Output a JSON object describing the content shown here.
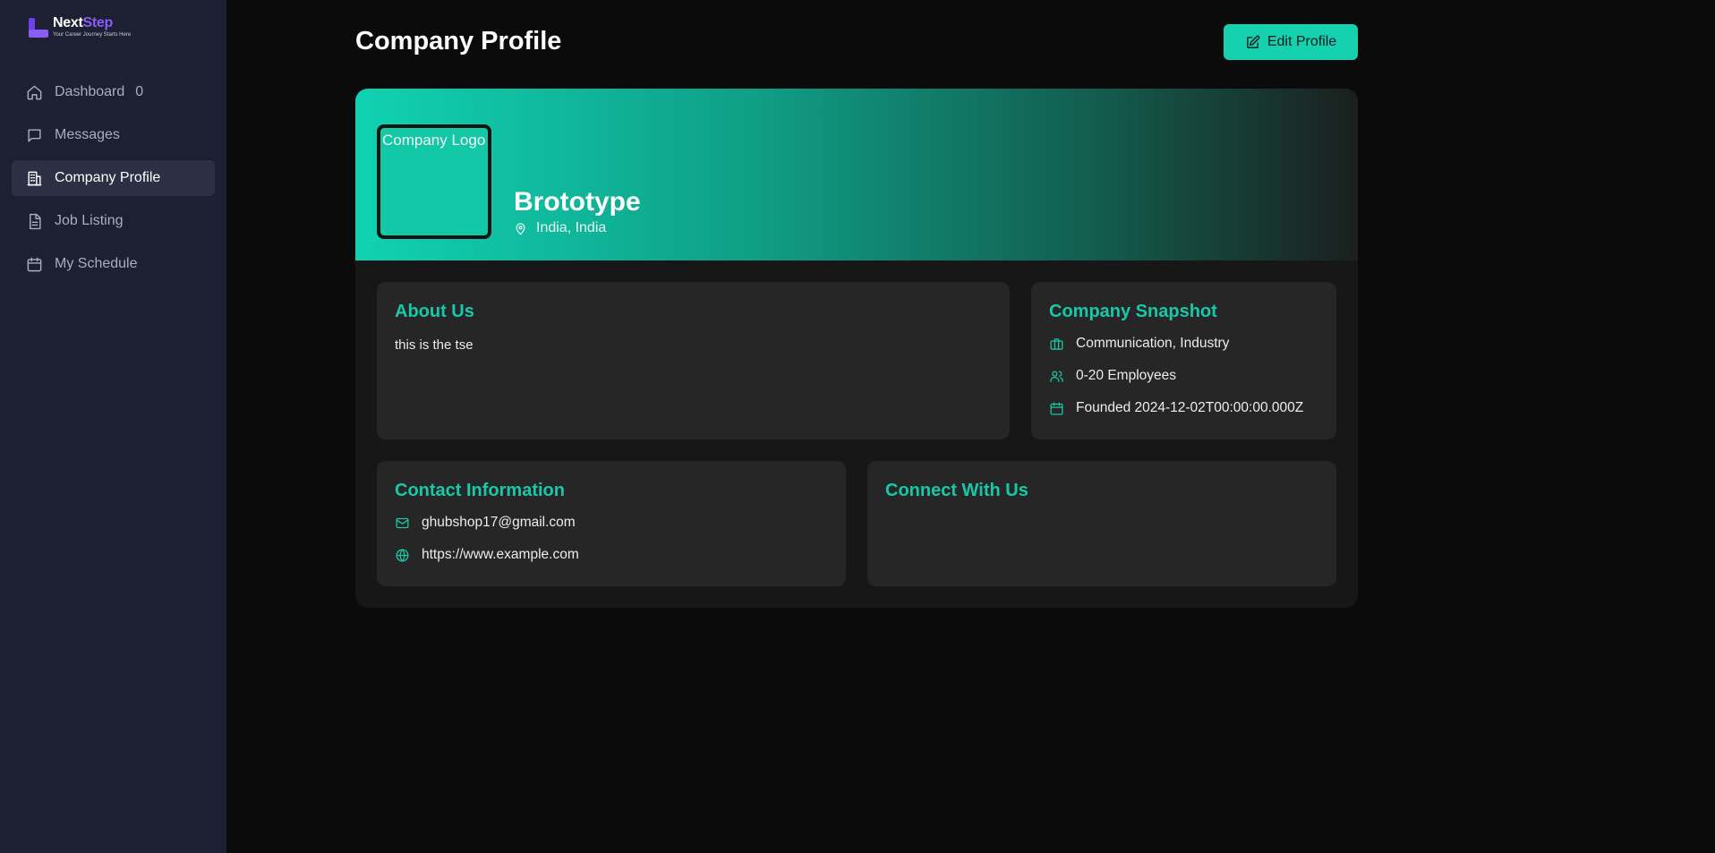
{
  "brand": {
    "name_part1": "Next",
    "name_part2": "Step",
    "tagline": "Your Career Journey Starts Here"
  },
  "sidebar": {
    "items": [
      {
        "label": "Dashboard",
        "badge": "0",
        "icon": "home-icon"
      },
      {
        "label": "Messages",
        "icon": "message-icon"
      },
      {
        "label": "Company Profile",
        "icon": "building-icon",
        "active": true
      },
      {
        "label": "Job Listing",
        "icon": "document-icon"
      },
      {
        "label": "My Schedule",
        "icon": "calendar-icon"
      }
    ]
  },
  "header": {
    "title": "Company Profile",
    "edit_label": "Edit Profile"
  },
  "company": {
    "logo_alt": "Company Logo",
    "name": "Brototype",
    "location": "India, India"
  },
  "about": {
    "title": "About Us",
    "text": "this is the tse"
  },
  "snapshot": {
    "title": "Company Snapshot",
    "industry": "Communication, Industry",
    "employees": "0-20 Employees",
    "founded": "Founded 2024-12-02T00:00:00.000Z"
  },
  "contact": {
    "title": "Contact Information",
    "email": "ghubshop17@gmail.com",
    "website": "https://www.example.com"
  },
  "connect": {
    "title": "Connect With Us"
  },
  "colors": {
    "accent": "#15d1b0",
    "sidebar_bg": "#1d2033",
    "page_bg": "#0b0b0c",
    "brand_purple": "#8b5cf6"
  }
}
